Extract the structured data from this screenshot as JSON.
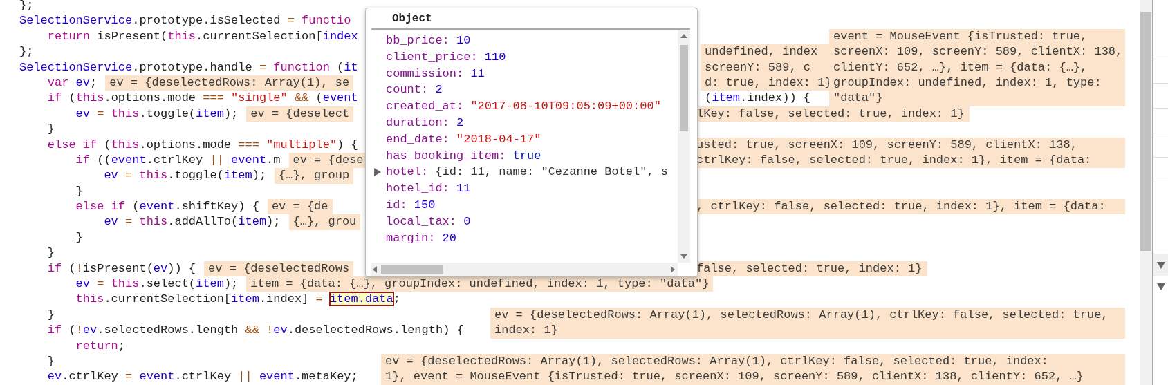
{
  "editor": {
    "lines": [
      {
        "code": [
          {
            "text": "};",
            "kind": "plain"
          }
        ]
      },
      {
        "code": [
          {
            "text": "SelectionService",
            "kind": "name"
          },
          {
            "text": ".prototype.isSelected ",
            "kind": "plain"
          },
          {
            "text": "= ",
            "kind": "operator"
          },
          {
            "text": "functio",
            "kind": "keyword"
          }
        ]
      },
      {
        "code": [
          {
            "text": "    return",
            "kind": "keyword"
          },
          {
            "text": " isPresent(",
            "kind": "plain"
          },
          {
            "text": "this",
            "kind": "keyword"
          },
          {
            "text": ".currentSelection[",
            "kind": "plain"
          },
          {
            "text": "index",
            "kind": "name"
          }
        ],
        "overlays": [
          {
            "kind": "hint",
            "text": "event = MouseEvent {isTrusted: true,"
          }
        ]
      },
      {
        "code": [
          {
            "text": "};",
            "kind": "plain"
          }
        ],
        "overlays": [
          {
            "kind": "hint",
            "text": "undefined, index"
          },
          {
            "kind": "hint",
            "text": "screenX: 109, screenY: 589, clientX: 138,"
          }
        ]
      },
      {
        "code": [
          {
            "text": "SelectionService",
            "kind": "name"
          },
          {
            "text": ".prototype.handle ",
            "kind": "plain"
          },
          {
            "text": "= ",
            "kind": "operator"
          },
          {
            "text": "function",
            "kind": "keyword"
          },
          {
            "text": " (",
            "kind": "plain"
          },
          {
            "text": "it",
            "kind": "name"
          }
        ],
        "overlays": [
          {
            "kind": "hint",
            "text": "screenY: 589, c"
          },
          {
            "kind": "hint",
            "text": "clientY: 652, …}, item = {data: {…},"
          }
        ]
      },
      {
        "code": [
          {
            "text": "    var",
            "kind": "keyword"
          },
          {
            "text": " ev",
            "kind": "name"
          },
          {
            "text": ";",
            "kind": "plain"
          }
        ],
        "inline_hint": "ev = {deselectedRows: Array(1), se",
        "overlays": [
          {
            "kind": "hint",
            "text": "d: true, index: 1}"
          },
          {
            "kind": "hint",
            "text": "groupIndex: undefined, index: 1, type:"
          }
        ]
      },
      {
        "code": [
          {
            "text": "    if",
            "kind": "keyword"
          },
          {
            "text": " (",
            "kind": "plain"
          },
          {
            "text": "this",
            "kind": "keyword"
          },
          {
            "text": ".options.mode ",
            "kind": "plain"
          },
          {
            "text": "=== ",
            "kind": "operator"
          },
          {
            "text": "\"single\" ",
            "kind": "string"
          },
          {
            "text": "&&",
            "kind": "operator"
          },
          {
            "text": " (",
            "kind": "plain"
          },
          {
            "text": "event",
            "kind": "name"
          }
        ],
        "overlays": [
          {
            "kind": "code",
            "tokens": [
              {
                "text": "(",
                "kind": "plain"
              },
              {
                "text": "item",
                "kind": "name"
              },
              {
                "text": ".index)) {",
                "kind": "plain"
              }
            ]
          },
          {
            "kind": "hint",
            "text": "\"data\"}"
          }
        ]
      },
      {
        "code": [
          {
            "text": "        ev ",
            "kind": "name"
          },
          {
            "text": "= ",
            "kind": "operator"
          },
          {
            "text": "this",
            "kind": "keyword"
          },
          {
            "text": ".toggle(",
            "kind": "plain"
          },
          {
            "text": "item",
            "kind": "name"
          },
          {
            "text": ");",
            "kind": "plain"
          }
        ],
        "inline_hint": "ev = {deselect",
        "overlays": [
          {
            "kind": "hint",
            "text": "lKey: false, selected: true, index: 1}"
          }
        ]
      },
      {
        "code": [
          {
            "text": "    }",
            "kind": "plain"
          }
        ]
      },
      {
        "code": [
          {
            "text": "    else if",
            "kind": "keyword"
          },
          {
            "text": " (",
            "kind": "plain"
          },
          {
            "text": "this",
            "kind": "keyword"
          },
          {
            "text": ".options.mode ",
            "kind": "plain"
          },
          {
            "text": "=== ",
            "kind": "operator"
          },
          {
            "text": "\"multiple\"",
            "kind": "string"
          },
          {
            "text": ") {",
            "kind": "plain"
          }
        ],
        "overlays": [
          {
            "kind": "hint",
            "text": "usted: true, screenX: 109, screenY: 589, clientX: 138,"
          }
        ]
      },
      {
        "code": [
          {
            "text": "        if",
            "kind": "keyword"
          },
          {
            "text": " ((",
            "kind": "plain"
          },
          {
            "text": "event",
            "kind": "name"
          },
          {
            "text": ".ctrlKey ",
            "kind": "plain"
          },
          {
            "text": "|| ",
            "kind": "operator"
          },
          {
            "text": "event",
            "kind": "name"
          },
          {
            "text": ".m",
            "kind": "plain"
          }
        ],
        "inline_hint": "ev = {dese",
        "overlays": [
          {
            "kind": "hint",
            "text": "ctrlKey: false, selected: true, index: 1}, item = {data:"
          }
        ]
      },
      {
        "code": [
          {
            "text": "            ev ",
            "kind": "name"
          },
          {
            "text": "= ",
            "kind": "operator"
          },
          {
            "text": "this",
            "kind": "keyword"
          },
          {
            "text": ".toggle(",
            "kind": "plain"
          },
          {
            "text": "item",
            "kind": "name"
          },
          {
            "text": ");",
            "kind": "plain"
          }
        ],
        "inline_hint": "{…}, group"
      },
      {
        "code": [
          {
            "text": "        }",
            "kind": "plain"
          }
        ]
      },
      {
        "code": [
          {
            "text": "        else if",
            "kind": "keyword"
          },
          {
            "text": " (",
            "kind": "plain"
          },
          {
            "text": "event",
            "kind": "name"
          },
          {
            "text": ".shiftKey) {",
            "kind": "plain"
          }
        ],
        "inline_hint": "ev = {de",
        "overlays": [
          {
            "kind": "hint",
            "text": ", ctrlKey: false, selected: true, index: 1}, item = {data:"
          }
        ]
      },
      {
        "code": [
          {
            "text": "            ev ",
            "kind": "name"
          },
          {
            "text": "= ",
            "kind": "operator"
          },
          {
            "text": "this",
            "kind": "keyword"
          },
          {
            "text": ".addAllTo(",
            "kind": "plain"
          },
          {
            "text": "item",
            "kind": "name"
          },
          {
            "text": ");",
            "kind": "plain"
          }
        ],
        "inline_hint": "{…}, grou"
      },
      {
        "code": [
          {
            "text": "        }",
            "kind": "plain"
          }
        ]
      },
      {
        "code": [
          {
            "text": "    }",
            "kind": "plain"
          }
        ]
      },
      {
        "code": [
          {
            "text": "    if",
            "kind": "keyword"
          },
          {
            "text": " (",
            "kind": "plain"
          },
          {
            "text": "!",
            "kind": "operator"
          },
          {
            "text": "isPresent(",
            "kind": "plain"
          },
          {
            "text": "ev",
            "kind": "name"
          },
          {
            "text": ")) {",
            "kind": "plain"
          }
        ],
        "inline_hint": "ev = {deselectedRows",
        "overlays": [
          {
            "kind": "hint",
            "text": "false, selected: true, index: 1}"
          }
        ]
      },
      {
        "code": [
          {
            "text": "        ev ",
            "kind": "name"
          },
          {
            "text": "= ",
            "kind": "operator"
          },
          {
            "text": "this",
            "kind": "keyword"
          },
          {
            "text": ".select(",
            "kind": "plain"
          },
          {
            "text": "item",
            "kind": "name"
          },
          {
            "text": ");",
            "kind": "plain"
          }
        ],
        "inline_hint": "item = {data: {…}, groupIndex: undefined, index: 1, type: \"data\"}"
      },
      {
        "code": [
          {
            "text": "        this",
            "kind": "keyword"
          },
          {
            "text": ".currentSelection[",
            "kind": "plain"
          },
          {
            "text": "item",
            "kind": "name"
          },
          {
            "text": ".index] ",
            "kind": "plain"
          },
          {
            "text": "= ",
            "kind": "operator"
          },
          {
            "text": "item.data",
            "kind": "selection"
          },
          {
            "text": ";",
            "kind": "plain"
          }
        ]
      },
      {
        "code": [
          {
            "text": "    }",
            "kind": "plain"
          }
        ],
        "overlays": [
          {
            "kind": "hint",
            "text": "ev = {deselectedRows: Array(1), selectedRows: Array(1), ctrlKey: false, selected: true,"
          }
        ]
      },
      {
        "code": [
          {
            "text": "    if",
            "kind": "keyword"
          },
          {
            "text": " (",
            "kind": "plain"
          },
          {
            "text": "!",
            "kind": "operator"
          },
          {
            "text": "ev",
            "kind": "name"
          },
          {
            "text": ".selectedRows.length ",
            "kind": "plain"
          },
          {
            "text": "&& !",
            "kind": "operator"
          },
          {
            "text": "ev",
            "kind": "name"
          },
          {
            "text": ".deselectedRows.length) {",
            "kind": "plain"
          }
        ],
        "overlays": [
          {
            "kind": "hint",
            "text": "index: 1}"
          }
        ]
      },
      {
        "code": [
          {
            "text": "        return",
            "kind": "keyword"
          },
          {
            "text": ";",
            "kind": "plain"
          }
        ]
      },
      {
        "code": [
          {
            "text": "    }",
            "kind": "plain"
          }
        ],
        "overlays": [
          {
            "kind": "hint",
            "text": "ev = {deselectedRows: Array(1), selectedRows: Array(1), ctrlKey: false, selected: true, index:"
          }
        ]
      },
      {
        "code": [
          {
            "text": "    ev",
            "kind": "name"
          },
          {
            "text": ".ctrlKey ",
            "kind": "plain"
          },
          {
            "text": "= ",
            "kind": "operator"
          },
          {
            "text": "event",
            "kind": "name"
          },
          {
            "text": ".ctrlKey ",
            "kind": "plain"
          },
          {
            "text": "|| ",
            "kind": "operator"
          },
          {
            "text": "event",
            "kind": "name"
          },
          {
            "text": ".metaKey;",
            "kind": "plain"
          }
        ],
        "overlays": [
          {
            "kind": "hint",
            "text": "1}, event = MouseEvent {isTrusted: true, screenX: 109, screenY: 589, clientX: 138, clientY: 652, …}"
          }
        ]
      }
    ]
  },
  "popover": {
    "title": "Object",
    "properties": [
      {
        "key": "bb_price:",
        "value": "10",
        "kind": "number"
      },
      {
        "key": "client_price:",
        "value": "110",
        "kind": "number"
      },
      {
        "key": "commission:",
        "value": "11",
        "kind": "number"
      },
      {
        "key": "count:",
        "value": "2",
        "kind": "number"
      },
      {
        "key": "created_at:",
        "value": "\"2017-08-10T09:05:09+00:00\"",
        "kind": "string"
      },
      {
        "key": "duration:",
        "value": "2",
        "kind": "number"
      },
      {
        "key": "end_date:",
        "value": "\"2018-04-17\"",
        "kind": "string"
      },
      {
        "key": "has_booking_item:",
        "value": "true",
        "kind": "boolean"
      },
      {
        "key": "hotel:",
        "value": "{id: 11, name: \"Cezanne Botel\", s",
        "kind": "object",
        "expanded": false
      },
      {
        "key": "hotel_id:",
        "value": "11",
        "kind": "number"
      },
      {
        "key": "id:",
        "value": "150",
        "kind": "number"
      },
      {
        "key": "local_tax:",
        "value": "0",
        "kind": "number"
      },
      {
        "key": "margin:",
        "value": "20",
        "kind": "number"
      }
    ]
  }
}
